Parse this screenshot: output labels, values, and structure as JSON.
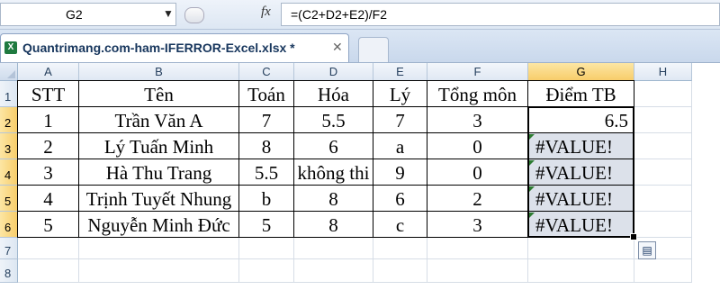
{
  "formula_bar": {
    "name_box": "G2",
    "fx_label": "fx",
    "formula": "=(C2+D2+E2)/F2"
  },
  "workbook_tab": {
    "title": "Quantrimang.com-ham-IFERROR-Excel.xlsx *",
    "excel_icon": "X",
    "close_glyph": "✕"
  },
  "columns": [
    "A",
    "B",
    "C",
    "D",
    "E",
    "F",
    "G",
    "H"
  ],
  "selected_column": "G",
  "rows": [
    "1",
    "2",
    "3",
    "4",
    "5",
    "6",
    "7",
    "8"
  ],
  "selected_rows": [
    "2",
    "3",
    "4",
    "5",
    "6"
  ],
  "table": {
    "headers": [
      "STT",
      "Tên",
      "Toán",
      "Hóa",
      "Lý",
      "Tổng môn",
      "Điểm TB"
    ],
    "rows": [
      [
        "1",
        "Trần Văn A",
        "7",
        "5.5",
        "7",
        "3",
        "6.5"
      ],
      [
        "2",
        "Lý Tuấn Minh",
        "8",
        "6",
        "a",
        "0",
        "#VALUE!"
      ],
      [
        "3",
        "Hà Thu Trang",
        "5.5",
        "không thi",
        "9",
        "0",
        "#VALUE!"
      ],
      [
        "4",
        "Trịnh Tuyết Nhung",
        "b",
        "8",
        "6",
        "2",
        "#VALUE!"
      ],
      [
        "5",
        "Nguyễn Minh Đức",
        "5",
        "8",
        "c",
        "3",
        "#VALUE!"
      ]
    ]
  },
  "colors": {
    "error_indicator": "#2e7d32",
    "selection_fill": "#dce1ea",
    "active_header": "#f8cd6a"
  },
  "icons": {
    "name_box_dropdown": "chevron-down-icon",
    "paste_options": "paste-options-icon",
    "excel_file": "excel-file-icon"
  }
}
